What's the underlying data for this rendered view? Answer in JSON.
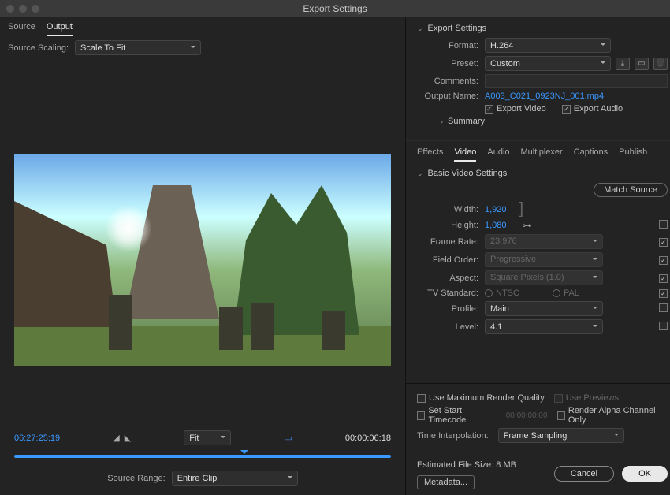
{
  "window": {
    "title": "Export Settings"
  },
  "left": {
    "tabs": {
      "source": "Source",
      "output": "Output"
    },
    "scaling_label": "Source Scaling:",
    "scaling_value": "Scale To Fit",
    "in_timecode": "06:27:25:19",
    "out_timecode": "00:00:06:18",
    "fit_label": "Fit",
    "source_range_label": "Source Range:",
    "source_range_value": "Entire Clip"
  },
  "export": {
    "heading": "Export Settings",
    "format_label": "Format:",
    "format_value": "H.264",
    "preset_label": "Preset:",
    "preset_value": "Custom",
    "comments_label": "Comments:",
    "outputname_label": "Output Name:",
    "outputname_value": "A003_C021_0923NJ_001.mp4",
    "export_video": "Export Video",
    "export_audio": "Export Audio",
    "summary": "Summary"
  },
  "tabs2": {
    "effects": "Effects",
    "video": "Video",
    "audio": "Audio",
    "multiplexer": "Multiplexer",
    "captions": "Captions",
    "publish": "Publish"
  },
  "video": {
    "heading": "Basic Video Settings",
    "match_source": "Match Source",
    "width_label": "Width:",
    "width": "1,920",
    "height_label": "Height:",
    "height": "1,080",
    "framerate_label": "Frame Rate:",
    "framerate": "23.976",
    "fieldorder_label": "Field Order:",
    "fieldorder": "Progressive",
    "aspect_label": "Aspect:",
    "aspect": "Square Pixels (1.0)",
    "tvstd_label": "TV Standard:",
    "ntsc": "NTSC",
    "pal": "PAL",
    "profile_label": "Profile:",
    "profile": "Main",
    "level_label": "Level:",
    "level": "4.1"
  },
  "bottom": {
    "max_quality": "Use Maximum Render Quality",
    "use_previews": "Use Previews",
    "set_start_tc": "Set Start Timecode",
    "start_tc": "00:00:00:00",
    "render_alpha": "Render Alpha Channel Only",
    "time_interp_label": "Time Interpolation:",
    "time_interp_value": "Frame Sampling",
    "filesize_label": "Estimated File Size:",
    "filesize_value": "8 MB",
    "metadata": "Metadata...",
    "cancel": "Cancel",
    "ok": "OK"
  }
}
